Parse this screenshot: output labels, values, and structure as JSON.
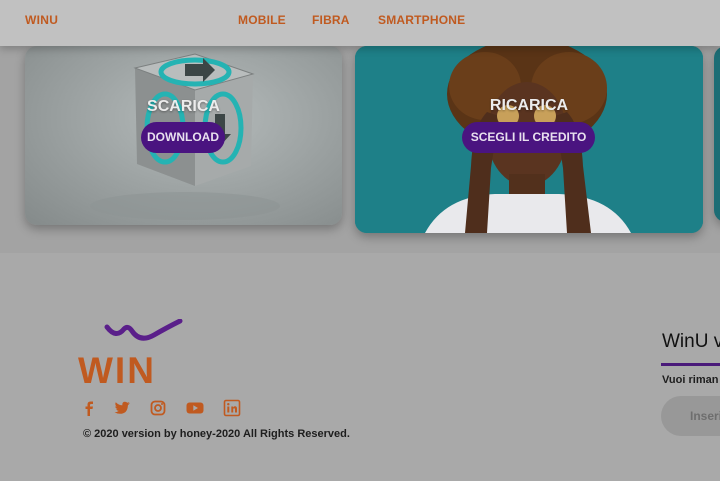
{
  "header": {
    "brand": "WINU",
    "nav": [
      {
        "label": "MOBILE"
      },
      {
        "label": "FIBRA"
      },
      {
        "label": "SMARTPHONE"
      }
    ]
  },
  "cards": {
    "download": {
      "title": "SCARICA",
      "button": "DOWNLOAD"
    },
    "recharge": {
      "title": "RICARICA",
      "button": "SCEGLI IL CREDITO"
    }
  },
  "footer": {
    "logo_text": "WIN",
    "social": [
      "facebook-icon",
      "twitter-icon",
      "instagram-icon",
      "youtube-icon",
      "linkedin-icon"
    ],
    "copyright": "© 2020 version by honey-2020 All Rights Reserved.",
    "newsletter": {
      "title": "WinU v",
      "text": "Vuoi riman",
      "placeholder": "Inseri"
    }
  },
  "colors": {
    "accent_orange": "#c05a20",
    "button_purple": "#4a1480",
    "logo_purple": "#5a1f8a"
  }
}
